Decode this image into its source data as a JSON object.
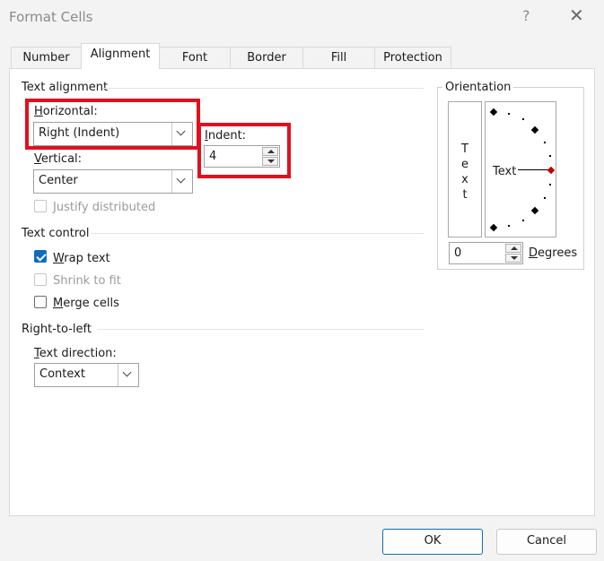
{
  "window": {
    "title": "Format Cells",
    "help_glyph": "?",
    "close_glyph": "✕"
  },
  "tabs": [
    {
      "label": "Number"
    },
    {
      "label": "Alignment"
    },
    {
      "label": "Font"
    },
    {
      "label": "Border"
    },
    {
      "label": "Fill"
    },
    {
      "label": "Protection"
    }
  ],
  "active_tab": "Alignment",
  "text_alignment": {
    "section_title": "Text alignment",
    "horizontal_label_u": "H",
    "horizontal_label_rest": "orizontal:",
    "horizontal_value": "Right (Indent)",
    "indent_label_u": "I",
    "indent_label_rest": "ndent:",
    "indent_value": "4",
    "vertical_label_u": "V",
    "vertical_label_rest": "ertical:",
    "vertical_value": "Center",
    "justify_distributed": "Justify distributed"
  },
  "text_control": {
    "section_title": "Text control",
    "wrap_u": "W",
    "wrap_rest": "rap text",
    "wrap_checked": true,
    "shrink": "Shrink to fit",
    "merge_u": "M",
    "merge_rest": "erge cells",
    "merge_checked": false
  },
  "rtl": {
    "section_title": "Right-to-left",
    "direction_label_u": "T",
    "direction_label_rest": "ext direction:",
    "direction_value": "Context"
  },
  "orientation": {
    "section_title": "Orientation",
    "vertical_letters": [
      "T",
      "e",
      "x",
      "t"
    ],
    "dial_text": "Text",
    "degrees_value": "0",
    "degrees_label_u": "D",
    "degrees_label_rest": "egrees"
  },
  "buttons": {
    "ok": "OK",
    "cancel": "Cancel"
  },
  "colors": {
    "highlight": "#e0101f",
    "accent": "#0f6cbd",
    "dial_marker": "#c00000"
  }
}
